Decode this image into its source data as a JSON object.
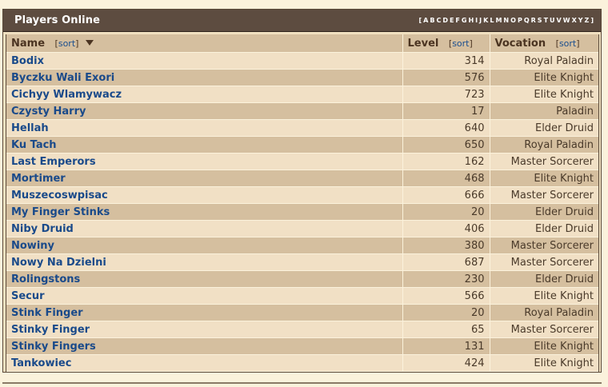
{
  "title": "Players Online",
  "alphabet": [
    "[",
    "A",
    "B",
    "C",
    "D",
    "E",
    "F",
    "G",
    "H",
    "I",
    "J",
    "K",
    "L",
    "M",
    "N",
    "O",
    "P",
    "Q",
    "R",
    "S",
    "T",
    "U",
    "V",
    "W",
    "X",
    "Y",
    "Z",
    "]"
  ],
  "columns": {
    "name": "Name",
    "level": "Level",
    "vocation": "Vocation",
    "sort_label": "sort"
  },
  "players": [
    {
      "name": "Bodix",
      "level": "314",
      "vocation": "Royal Paladin"
    },
    {
      "name": "Byczku Wali Exori",
      "level": "576",
      "vocation": "Elite Knight"
    },
    {
      "name": "Cichyy Wlamywacz",
      "level": "723",
      "vocation": "Elite Knight"
    },
    {
      "name": "Czysty Harry",
      "level": "17",
      "vocation": "Paladin"
    },
    {
      "name": "Hellah",
      "level": "640",
      "vocation": "Elder Druid"
    },
    {
      "name": "Ku Tach",
      "level": "650",
      "vocation": "Royal Paladin"
    },
    {
      "name": "Last Emperors",
      "level": "162",
      "vocation": "Master Sorcerer"
    },
    {
      "name": "Mortimer",
      "level": "468",
      "vocation": "Elite Knight"
    },
    {
      "name": "Muszecoswpisac",
      "level": "666",
      "vocation": "Master Sorcerer"
    },
    {
      "name": "My Finger Stinks",
      "level": "20",
      "vocation": "Elder Druid"
    },
    {
      "name": "Niby Druid",
      "level": "406",
      "vocation": "Elder Druid"
    },
    {
      "name": "Nowiny",
      "level": "380",
      "vocation": "Master Sorcerer"
    },
    {
      "name": "Nowy Na Dzielni",
      "level": "687",
      "vocation": "Master Sorcerer"
    },
    {
      "name": "Rolingstons",
      "level": "230",
      "vocation": "Elder Druid"
    },
    {
      "name": "Secur",
      "level": "566",
      "vocation": "Elite Knight"
    },
    {
      "name": "Stink Finger",
      "level": "20",
      "vocation": "Royal Paladin"
    },
    {
      "name": "Stinky Finger",
      "level": "65",
      "vocation": "Master Sorcerer"
    },
    {
      "name": "Stinky Fingers",
      "level": "131",
      "vocation": "Elite Knight"
    },
    {
      "name": "Tankowiec",
      "level": "424",
      "vocation": "Elite Knight"
    }
  ]
}
